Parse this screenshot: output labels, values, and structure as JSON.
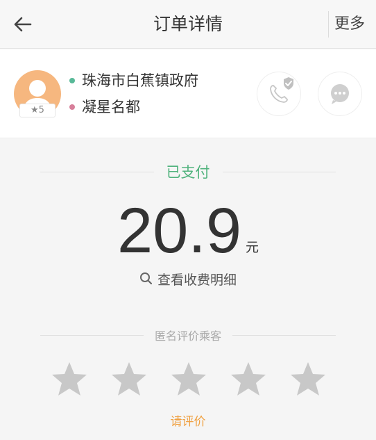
{
  "header": {
    "title": "订单详情",
    "more_label": "更多",
    "back_icon": "arrow-left-icon"
  },
  "driver": {
    "rating": "★5",
    "origin": "珠海市白蕉镇政府",
    "destination": "凝星名都",
    "origin_dot_color": "#58b998",
    "destination_dot_color": "#d77f9a"
  },
  "payment": {
    "status": "已支付",
    "amount": "20.9",
    "unit": "元",
    "detail_link": "查看收费明细"
  },
  "rating": {
    "prompt": "匿名评价乘客",
    "stars": [
      {
        "filled": false
      },
      {
        "filled": false
      },
      {
        "filled": false
      },
      {
        "filled": false
      },
      {
        "filled": false
      }
    ],
    "action_label": "请评价"
  },
  "colors": {
    "accent_green": "#4fb27c",
    "accent_orange": "#f0a040",
    "star_gray": "#c8c8c8"
  }
}
